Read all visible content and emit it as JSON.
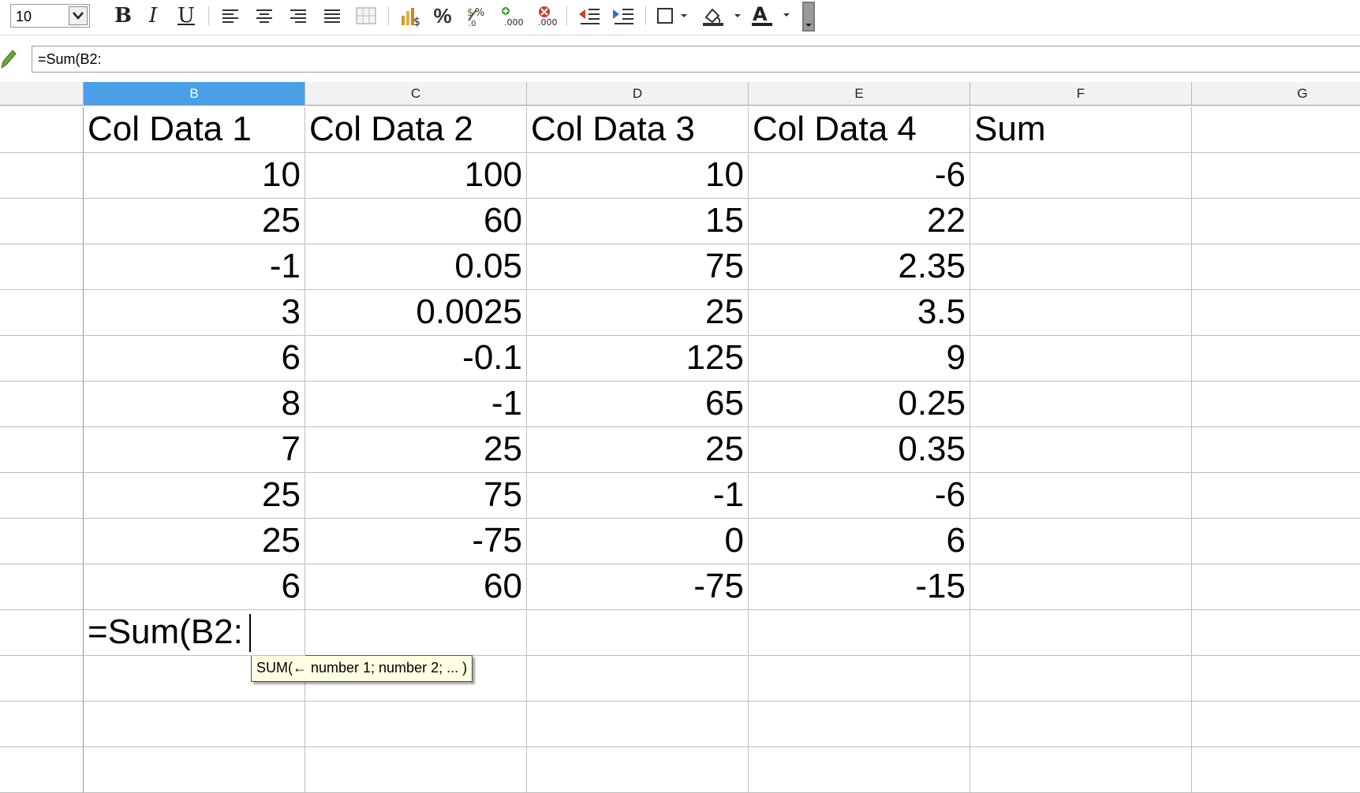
{
  "toolbar": {
    "font_size": "10",
    "icons": [
      "bold-icon",
      "italic-icon",
      "underline-icon",
      "align-left-icon",
      "align-center-icon",
      "align-right-icon",
      "justify-icon",
      "merge-cells-icon",
      "currency-icon",
      "percent-icon",
      "standard-format-icon",
      "add-decimal-icon",
      "delete-decimal-icon",
      "decrease-indent-icon",
      "increase-indent-icon",
      "borders-icon",
      "background-color-icon",
      "font-color-icon"
    ]
  },
  "formula_bar": {
    "value": "=Sum(B2:"
  },
  "columns": [
    "B",
    "C",
    "D",
    "E",
    "F",
    "G"
  ],
  "selected_column": "B",
  "headers": [
    "Col Data 1",
    "Col Data 2",
    "Col Data 3",
    "Col Data 4",
    "Sum"
  ],
  "rows": [
    [
      "10",
      "100",
      "10",
      "-6"
    ],
    [
      "25",
      "60",
      "15",
      "22"
    ],
    [
      "-1",
      "0.05",
      "75",
      "2.35"
    ],
    [
      "3",
      "0.0025",
      "25",
      "3.5"
    ],
    [
      "6",
      "-0.1",
      "125",
      "9"
    ],
    [
      "8",
      "-1",
      "65",
      "0.25"
    ],
    [
      "7",
      "25",
      "25",
      "0.35"
    ],
    [
      "25",
      "75",
      "-1",
      "-6"
    ],
    [
      "25",
      "-75",
      "0",
      "6"
    ],
    [
      "6",
      "60",
      "-75",
      "-15"
    ]
  ],
  "editing_cell": {
    "value": "=Sum(B2:"
  },
  "tooltip": {
    "text": "SUM(← number 1; number 2; ... )"
  },
  "colors": {
    "selected_header": "#4a9fe6",
    "tooltip_bg": "#ffffe1"
  }
}
